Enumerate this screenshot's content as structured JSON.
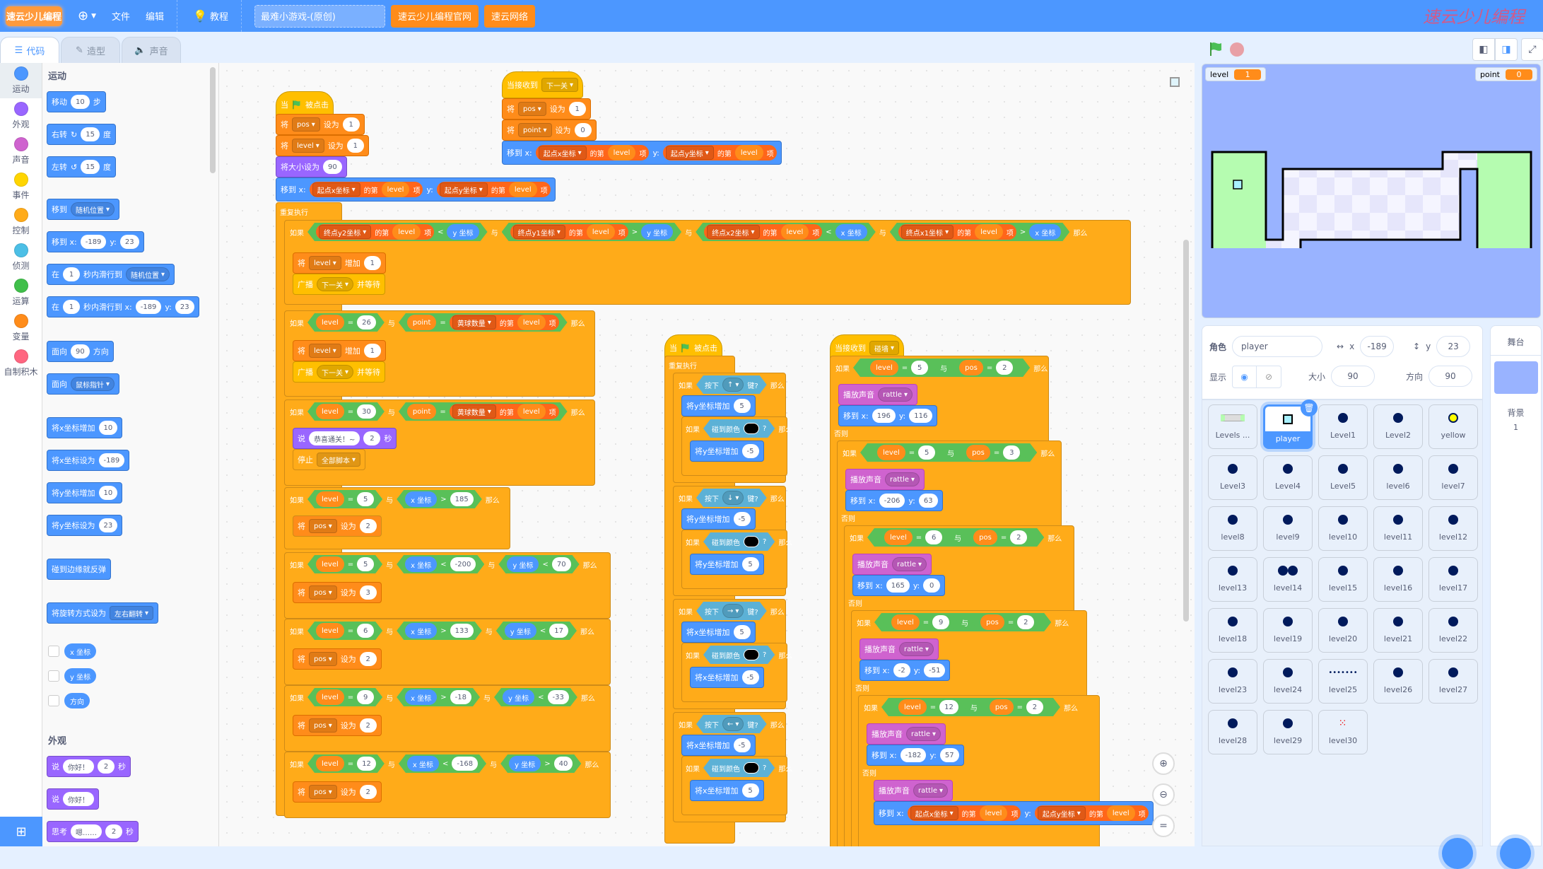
{
  "menubar": {
    "logo": "速云少儿编程",
    "globe_icon": "globe-icon",
    "file": "文件",
    "edit": "编辑",
    "tutorial": "教程",
    "project_title": "最难小游戏-(原创)",
    "btn_official": "速云少儿编程官网",
    "btn_network": "速云网络",
    "brand": "速云少儿编程"
  },
  "tabs": [
    {
      "label": "代码",
      "icon": "code-icon",
      "active": true
    },
    {
      "label": "造型",
      "icon": "brush-icon",
      "active": false
    },
    {
      "label": "声音",
      "icon": "speaker-icon",
      "active": false
    }
  ],
  "categories": [
    {
      "label": "运动",
      "color": "#4c97ff"
    },
    {
      "label": "外观",
      "color": "#9966ff"
    },
    {
      "label": "声音",
      "color": "#cf63cf"
    },
    {
      "label": "事件",
      "color": "#ffd500"
    },
    {
      "label": "控制",
      "color": "#ffab19"
    },
    {
      "label": "侦测",
      "color": "#4cbfe6"
    },
    {
      "label": "运算",
      "color": "#40bf4a"
    },
    {
      "label": "变量",
      "color": "#ff8c1a"
    },
    {
      "label": "自制积木",
      "color": "#ff6680"
    }
  ],
  "palette": {
    "motion_header": "运动",
    "move": {
      "a": "移动",
      "v": "10",
      "b": "步"
    },
    "turn_right": {
      "a": "右转",
      "v": "15",
      "b": "度"
    },
    "turn_left": {
      "a": "左转",
      "v": "15",
      "b": "度"
    },
    "goto": {
      "a": "移到",
      "dd": "随机位置"
    },
    "goto_xy": {
      "a": "移到 x:",
      "x": "-189",
      "b": "y:",
      "y": "23"
    },
    "glide": {
      "a": "在",
      "v": "1",
      "b": "秒内滑行到",
      "dd": "随机位置"
    },
    "glide_xy": {
      "a": "在",
      "v": "1",
      "b": "秒内滑行到 x:",
      "x": "-189",
      "c": "y:",
      "y": "23"
    },
    "point_dir": {
      "a": "面向",
      "v": "90",
      "b": "方向"
    },
    "point_towards": {
      "a": "面向",
      "dd": "鼠标指针"
    },
    "change_x": {
      "a": "将x坐标增加",
      "v": "10"
    },
    "set_x": {
      "a": "将x坐标设为",
      "v": "-189"
    },
    "change_y": {
      "a": "将y坐标增加",
      "v": "10"
    },
    "set_y": {
      "a": "将y坐标设为",
      "v": "23"
    },
    "bounce": "碰到边缘就反弹",
    "rotation": {
      "a": "将旋转方式设为",
      "dd": "左右翻转"
    },
    "rep_x": "x 坐标",
    "rep_y": "y 坐标",
    "rep_dir": "方向",
    "looks_header": "外观",
    "say_secs": {
      "a": "说",
      "v": "你好！",
      "n": "2",
      "b": "秒"
    },
    "say": {
      "a": "说",
      "v": "你好！"
    },
    "think_secs": {
      "a": "思考",
      "v": "嗯……",
      "n": "2",
      "b": "秒"
    }
  },
  "words": {
    "when": "当",
    "clicked": "被点击",
    "set": "将",
    "to": "设为",
    "change": "增加",
    "size_to": "将大小设为",
    "goto_x": "移到 x:",
    "y": "y:",
    "forever": "重复执行",
    "if": "如果",
    "then": "那么",
    "else": "否则",
    "and": "与",
    "of_item": "的第",
    "item": "项",
    "broadcast": "广播",
    "and_wait": "并等待",
    "say": "说",
    "secs": "秒",
    "stop": "停止",
    "receive": "当接收到",
    "key_press": "按下",
    "key_q": "键?",
    "touch_color": "碰到颜色",
    "q": "?",
    "play_sound": "播放声音",
    "change_y": "将y坐标增加",
    "change_x": "将x坐标增加",
    "eq": "=",
    "lt": "<",
    "gt": ">"
  },
  "vars": {
    "pos": "pos",
    "level": "level",
    "point": "point"
  },
  "lists": {
    "sx": "起点x坐标",
    "sy": "起点y坐标",
    "ey2": "终点y2坐标",
    "ey1": "终点y1坐标",
    "ex2": "终点x2坐标",
    "ex1": "终点x1坐标",
    "yb": "黄球数量"
  },
  "reporters": {
    "x": "x 坐标",
    "y": "y 坐标"
  },
  "msg": {
    "next": "下一关",
    "wall": "碰墙",
    "stop_all": "全部脚本",
    "congrats": "恭喜通关！~",
    "sound": "rattle"
  },
  "script1": {
    "pos_init": "1",
    "level_init": "1",
    "size": "90",
    "if26": {
      "level": "26"
    },
    "if30": {
      "level": "30",
      "say_secs": "2"
    },
    "c5a": {
      "level": "5",
      "x": "185",
      "pos": "2"
    },
    "c5b": {
      "level": "5",
      "x": "-200",
      "y": "70",
      "pos": "3"
    },
    "c6": {
      "level": "6",
      "x": "133",
      "y": "17",
      "pos": "2"
    },
    "c9": {
      "level": "9",
      "x": "-18",
      "y": "-33",
      "pos": "2"
    },
    "c12": {
      "level": "12",
      "x": "-168",
      "y": "40",
      "pos": "2"
    },
    "inc": "1"
  },
  "script2": {
    "pos": "1",
    "point": "0"
  },
  "script3": {
    "keys": [
      "↑",
      "↓",
      "→",
      "←"
    ],
    "amt": [
      "5",
      "-5",
      "-5",
      "5",
      "5",
      "-5",
      "-5",
      "5"
    ]
  },
  "script4": {
    "b1": {
      "level": "5",
      "pos": "2",
      "x": "196",
      "y": "116"
    },
    "b2": {
      "level": "5",
      "pos": "3",
      "x": "-206",
      "y": "63"
    },
    "b3": {
      "level": "6",
      "pos": "2",
      "x": "165",
      "y": "0"
    },
    "b4": {
      "level": "9",
      "pos": "2",
      "x": "-2",
      "y": "-51"
    },
    "b5": {
      "level": "12",
      "pos": "2",
      "x": "-182",
      "y": "57"
    }
  },
  "stage": {
    "monitor_level": {
      "label": "level",
      "value": "1"
    },
    "monitor_point": {
      "label": "point",
      "value": "0"
    }
  },
  "sprite_info": {
    "sprite_label": "角色",
    "sprite_name": "player",
    "x_label": "x",
    "x": "-189",
    "y_label": "y",
    "y": "23",
    "show_label": "显示",
    "size_label": "大小",
    "size": "90",
    "dir_label": "方向",
    "dir": "90"
  },
  "sprites": [
    "Levels ...",
    "player",
    "Level1",
    "Level2",
    "yellow",
    "Level3",
    "Level4",
    "Level5",
    "level6",
    "level7",
    "level8",
    "level9",
    "level10",
    "level11",
    "level12",
    "level13",
    "level14",
    "level15",
    "level16",
    "level17",
    "level18",
    "level19",
    "level20",
    "level21",
    "level22",
    "level23",
    "level24",
    "level25",
    "level26",
    "level27",
    "level28",
    "level29",
    "level30"
  ],
  "selected_sprite": "player",
  "stage_pane": {
    "title": "舞台",
    "backdrop_label": "背景",
    "backdrop_count": "1"
  }
}
